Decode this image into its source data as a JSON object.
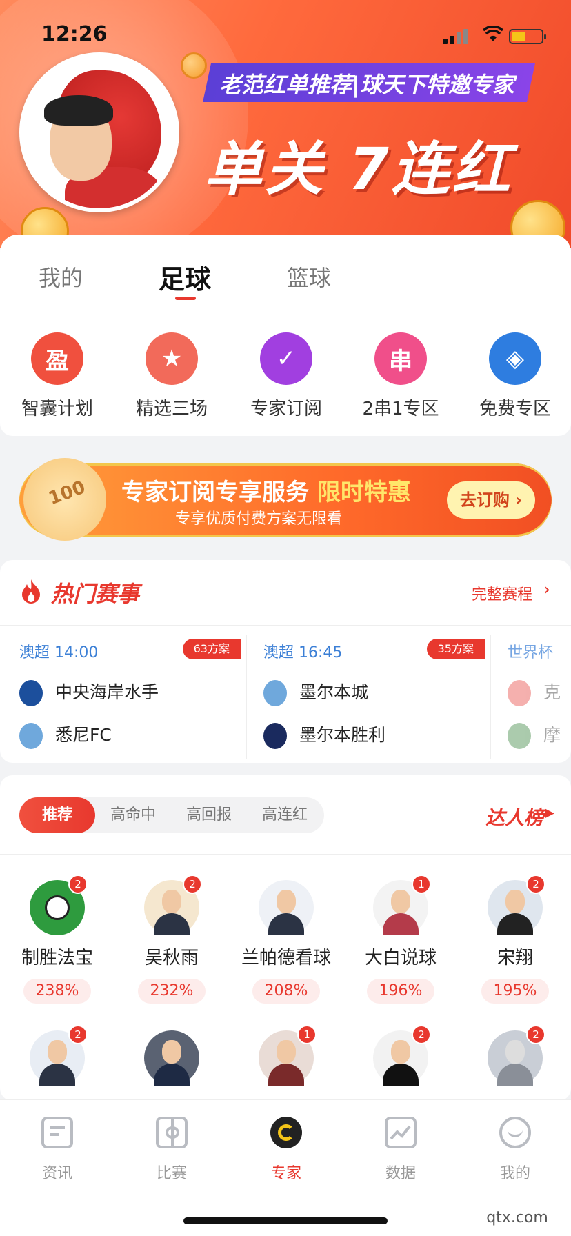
{
  "status": {
    "time": "12:26"
  },
  "banner": {
    "ribbon": "老范红单推荐|球天下特邀专家",
    "headline": "单关 7连红"
  },
  "tabs": [
    "我的",
    "足球",
    "篮球"
  ],
  "quick_links": [
    {
      "label": "智囊计划",
      "glyph": "盈",
      "color": "#f0503e",
      "icon": "wisdom-plan-icon"
    },
    {
      "label": "精选三场",
      "glyph": "★",
      "color": "#f26a5a",
      "icon": "star-icon"
    },
    {
      "label": "专家订阅",
      "glyph": "✓",
      "color": "#a13fe0",
      "icon": "expert-subscribe-icon"
    },
    {
      "label": "2串1专区",
      "glyph": "串",
      "color": "#f04f8a",
      "icon": "parlay-icon"
    },
    {
      "label": "免费专区",
      "glyph": "◈",
      "color": "#2e7de0",
      "icon": "free-tag-icon"
    }
  ],
  "promo": {
    "title_a": "专家订阅专享服务",
    "title_b": "限时特惠",
    "subtitle": "专享优质付费方案无限看",
    "button": "去订购"
  },
  "hot": {
    "title": "热门赛事",
    "link": "完整赛程",
    "matches": [
      {
        "league": "澳超 14:00",
        "count": "63方案",
        "home": "中央海岸水手",
        "away": "悉尼FC",
        "home_color": "#1c4f9c",
        "away_color": "#6fa8dc"
      },
      {
        "league": "澳超 16:45",
        "count": "35方案",
        "home": "墨尔本城",
        "away": "墨尔本胜利",
        "home_color": "#6fa8dc",
        "away_color": "#1a2a5e"
      },
      {
        "league": "世界杯",
        "count": "",
        "home": "克",
        "away": "摩",
        "home_color": "#e53935",
        "away_color": "#2e7d32"
      }
    ]
  },
  "experts": {
    "filters": [
      "推荐",
      "高命中",
      "高回报",
      "高连红"
    ],
    "rank_label": "达人榜",
    "row1": [
      {
        "name": "制胜法宝",
        "rate": "238%",
        "badge": "2",
        "bg": "#2e9b3e"
      },
      {
        "name": "吴秋雨",
        "rate": "232%",
        "badge": "2",
        "bg": "#f5e7cf"
      },
      {
        "name": "兰帕德看球",
        "rate": "208%",
        "badge": "",
        "bg": "#eef1f6"
      },
      {
        "name": "大白说球",
        "rate": "196%",
        "badge": "1",
        "bg": "#f3f3f3"
      },
      {
        "name": "宋翔",
        "rate": "195%",
        "badge": "2",
        "bg": "#dfe6ee"
      }
    ],
    "row2": [
      {
        "badge": "2",
        "bg": "#e8edf4"
      },
      {
        "badge": "",
        "bg": "#5a6272"
      },
      {
        "badge": "1",
        "bg": "#e9dcd6"
      },
      {
        "badge": "2",
        "bg": "#f2f2f2"
      },
      {
        "badge": "2",
        "bg": "#c9ced6"
      }
    ]
  },
  "nav": [
    {
      "label": "资讯",
      "icon": "news-icon"
    },
    {
      "label": "比赛",
      "icon": "match-icon"
    },
    {
      "label": "专家",
      "icon": "expert-icon"
    },
    {
      "label": "数据",
      "icon": "data-chart-icon"
    },
    {
      "label": "我的",
      "icon": "profile-icon"
    }
  ],
  "watermark": "qtx.com"
}
